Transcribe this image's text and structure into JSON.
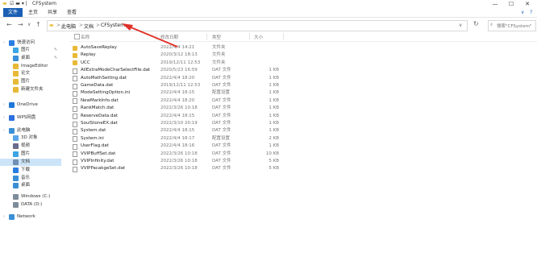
{
  "window": {
    "title": "CFSystem",
    "controls": [
      "—",
      "☐",
      "✕"
    ]
  },
  "ribbon": {
    "tabs": [
      "文件",
      "主页",
      "共享",
      "查看"
    ],
    "help": "?"
  },
  "address": {
    "back": "←",
    "forward": "→",
    "recent": "∨",
    "up": "↑",
    "crumbs": [
      "此电脑",
      "文档",
      "CFSystem"
    ],
    "separator": ">",
    "dropdown": "∨",
    "refresh": "↻",
    "search_placeholder": "搜索\"CFSystem\""
  },
  "sidebar": {
    "items": [
      {
        "label": "快速访问",
        "icon": "star-icon",
        "color": "#2a7de1",
        "indent": 0
      },
      {
        "label": "图片",
        "icon": "pictures-icon",
        "color": "#3ca5e6",
        "indent": 1,
        "pin": true
      },
      {
        "label": "桌面",
        "icon": "desktop-icon",
        "color": "#3a8fd6",
        "indent": 1,
        "pin": true
      },
      {
        "label": "ImageEditor",
        "icon": "folder-icon",
        "color": "#e8b936",
        "indent": 1
      },
      {
        "label": "论文",
        "icon": "folder-icon",
        "color": "#e8b936",
        "indent": 1
      },
      {
        "label": "图片",
        "icon": "folder-icon",
        "color": "#e8b936",
        "indent": 1
      },
      {
        "label": "新建文件夹",
        "icon": "folder-icon",
        "color": "#e8b936",
        "indent": 1
      },
      {
        "label": "OneDrive",
        "icon": "cloud-icon",
        "color": "#1e78d7",
        "indent": 0
      },
      {
        "label": "WPS网盘",
        "icon": "cloud-icon",
        "color": "#2c6fe0",
        "indent": 0
      },
      {
        "label": "此电脑",
        "icon": "computer-icon",
        "color": "#3a8fd6",
        "indent": 0
      },
      {
        "label": "3D 对象",
        "icon": "cube-icon",
        "color": "#5aa7e6",
        "indent": 1
      },
      {
        "label": "视频",
        "icon": "video-icon",
        "color": "#6b6b8a",
        "indent": 1
      },
      {
        "label": "图片",
        "icon": "pictures-icon",
        "color": "#3ca5e6",
        "indent": 1
      },
      {
        "label": "文档",
        "icon": "documents-icon",
        "color": "#6f8fb3",
        "indent": 1,
        "selected": true
      },
      {
        "label": "下载",
        "icon": "download-icon",
        "color": "#2a7de1",
        "indent": 1
      },
      {
        "label": "音乐",
        "icon": "music-icon",
        "color": "#3a8fd6",
        "indent": 1
      },
      {
        "label": "桌面",
        "icon": "desktop-icon",
        "color": "#3a8fd6",
        "indent": 1
      },
      {
        "label": "Windows (C:)",
        "icon": "drive-icon",
        "color": "#7f8c99",
        "indent": 1
      },
      {
        "label": "DATA (D:)",
        "icon": "drive-icon",
        "color": "#7f8c99",
        "indent": 1
      },
      {
        "label": "Network",
        "icon": "network-icon",
        "color": "#3a8fd6",
        "indent": 0
      }
    ]
  },
  "columns": {
    "name": "名称",
    "modified": "修改日期",
    "type": "类型",
    "size": "大小"
  },
  "files": [
    {
      "name": "AutoSaveReplay",
      "modified": "2022/4/4 14:21",
      "type": "文件夹",
      "size": "",
      "kind": "folder"
    },
    {
      "name": "Replay",
      "modified": "2020/3/12 18:13",
      "type": "文件夹",
      "size": "",
      "kind": "folder"
    },
    {
      "name": "UCC",
      "modified": "2019/12/11 12:53",
      "type": "文件夹",
      "size": "",
      "kind": "folder"
    },
    {
      "name": "AllExtraModeCharSelectFile.dat",
      "modified": "2020/5/23 16:59",
      "type": "DAT 文件",
      "size": "1 KB",
      "kind": "file"
    },
    {
      "name": "AutoMathSetting.dat",
      "modified": "2022/4/4 18:20",
      "type": "DAT 文件",
      "size": "1 KB",
      "kind": "file"
    },
    {
      "name": "GameData.dat",
      "modified": "2019/12/11 12:53",
      "type": "DAT 文件",
      "size": "1 KB",
      "kind": "file"
    },
    {
      "name": "ModeSettingOption.ini",
      "modified": "2022/4/4 18:15",
      "type": "配置设置",
      "size": "1 KB",
      "kind": "file"
    },
    {
      "name": "NewMarkInfo.dat",
      "modified": "2022/4/4 18:20",
      "type": "DAT 文件",
      "size": "1 KB",
      "kind": "file"
    },
    {
      "name": "RankMatch.dat",
      "modified": "2022/3/26 10:18",
      "type": "DAT 文件",
      "size": "1 KB",
      "kind": "file"
    },
    {
      "name": "ReserveData.dat",
      "modified": "2022/4/4 18:15",
      "type": "DAT 文件",
      "size": "1 KB",
      "kind": "file"
    },
    {
      "name": "SoulStoneEX.dat",
      "modified": "2022/3/10 20:19",
      "type": "DAT 文件",
      "size": "1 KB",
      "kind": "file"
    },
    {
      "name": "System.dat",
      "modified": "2022/4/4 18:15",
      "type": "DAT 文件",
      "size": "1 KB",
      "kind": "file"
    },
    {
      "name": "System.ini",
      "modified": "2022/4/4 18:17",
      "type": "配置设置",
      "size": "2 KB",
      "kind": "file"
    },
    {
      "name": "UserFlag.dat",
      "modified": "2022/4/4 18:16",
      "type": "DAT 文件",
      "size": "1 KB",
      "kind": "file"
    },
    {
      "name": "VVIPBuffSet.dat",
      "modified": "2022/3/26 10:18",
      "type": "DAT 文件",
      "size": "10 KB",
      "kind": "file"
    },
    {
      "name": "VVIPInfinity.dat",
      "modified": "2022/3/26 10:18",
      "type": "DAT 文件",
      "size": "5 KB",
      "kind": "file"
    },
    {
      "name": "VVIPPacakgeSet.dat",
      "modified": "2022/3/26 10:18",
      "type": "DAT 文件",
      "size": "5 KB",
      "kind": "file"
    }
  ],
  "annotation_color": "#e0322a"
}
